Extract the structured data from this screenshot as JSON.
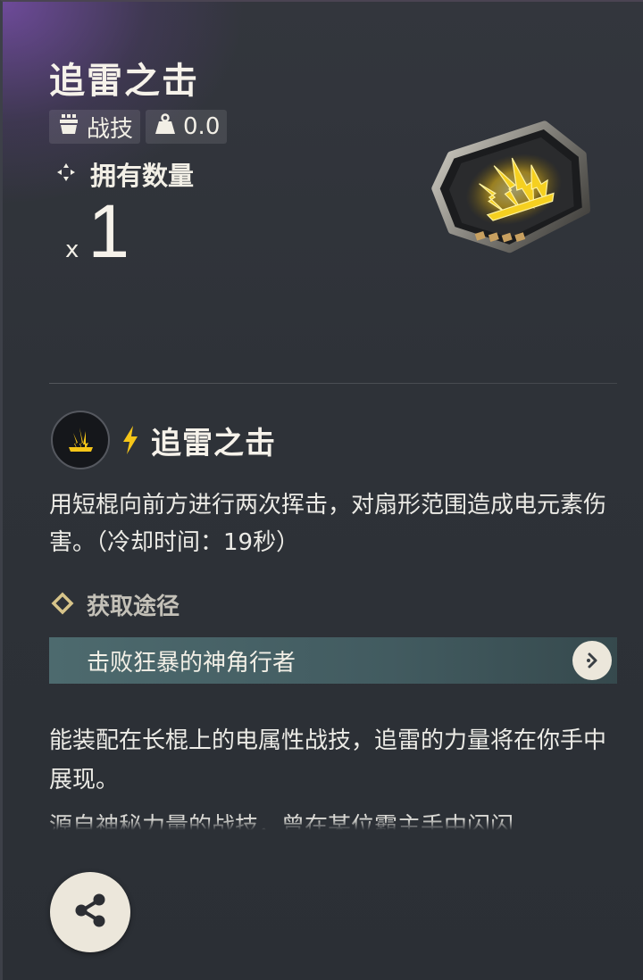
{
  "item": {
    "name": "追雷之击",
    "type_label": "战技",
    "weight_value": "0.0",
    "owned_label": "拥有数量",
    "count_prefix": "x",
    "count": "1",
    "icon": "lightning-strike-chip-icon"
  },
  "skill": {
    "name": "追雷之击",
    "element_icon": "lightning-bolt-icon",
    "description": "用短棍向前方进行两次挥击，对扇形范围造成电元素伤害。（冷却时间：19秒）"
  },
  "obtain": {
    "label": "获取途径",
    "source": "击败狂暴的神角行者"
  },
  "flavor": {
    "text": "能装配在长棍上的电属性战技，追雷的力量将在你手中展现。",
    "text_cut": "源自神秘力量的战技，曾在某位霸主手中闪闪"
  },
  "colors": {
    "accent_gold": "#f5c518",
    "source_bar": "#4d6a6e",
    "button_bg": "#ece7db"
  },
  "actions": {
    "share_icon": "share-icon"
  }
}
